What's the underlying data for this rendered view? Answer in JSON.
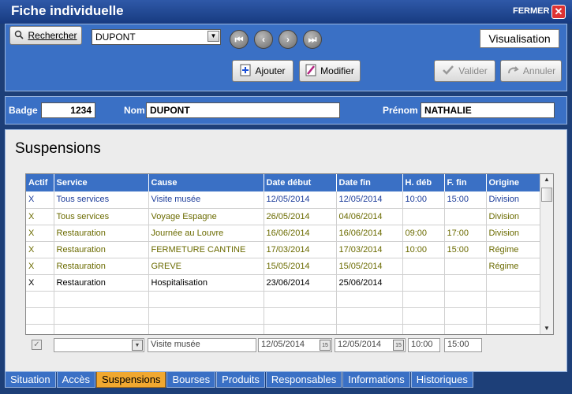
{
  "window": {
    "title": "Fiche individuelle",
    "close_label": "FERMER",
    "close_glyph": "✕"
  },
  "toolbar": {
    "search_label": "Rechercher",
    "search_icon": "magnifier-icon",
    "record_select_value": "DUPONT",
    "nav": {
      "first": "⏮",
      "prev": "‹",
      "next": "›",
      "last": "⏭"
    },
    "mode": "Visualisation",
    "add_label": "Ajouter",
    "edit_label": "Modifier",
    "validate_label": "Valider",
    "cancel_label": "Annuler"
  },
  "identity": {
    "badge_label": "Badge",
    "badge_value": "1234",
    "nom_label": "Nom",
    "nom_value": "DUPONT",
    "prenom_label": "Prénom",
    "prenom_value": "NATHALIE"
  },
  "section": {
    "title": "Suspensions"
  },
  "table": {
    "columns": [
      "Actif",
      "Service",
      "Cause",
      "Date début",
      "Date fin",
      "H. déb",
      "F. fin",
      "Origine"
    ],
    "rows": [
      [
        "X",
        "Tous services",
        "Visite musée",
        "12/05/2014",
        "12/05/2014",
        "10:00",
        "15:00",
        "Division"
      ],
      [
        "X",
        "Tous services",
        "Voyage Espagne",
        "26/05/2014",
        "04/06/2014",
        "",
        "",
        "Division"
      ],
      [
        "X",
        "Restauration",
        "Journée au Louvre",
        "16/06/2014",
        "16/06/2014",
        "09:00",
        "17:00",
        "Division"
      ],
      [
        "X",
        "Restauration",
        "FERMETURE CANTINE",
        "17/03/2014",
        "17/03/2014",
        "10:00",
        "15:00",
        "Régime"
      ],
      [
        "X",
        "Restauration",
        "GREVE",
        "15/05/2014",
        "15/05/2014",
        "",
        "",
        "Régime"
      ],
      [
        "X",
        "Restauration",
        "Hospitalisation",
        "23/06/2014",
        "25/06/2014",
        "",
        "",
        ""
      ]
    ]
  },
  "editor": {
    "service": "",
    "cause": "Visite musée",
    "date_debut": "12/05/2014",
    "date_fin": "12/05/2014",
    "heure_debut": "10:00",
    "heure_fin": "15:00",
    "cal_glyph": "15"
  },
  "tabs": [
    "Situation",
    "Accès",
    "Suspensions",
    "Bourses",
    "Produits",
    "Responsables",
    "Informations",
    "Historiques"
  ],
  "active_tab": "Suspensions"
}
